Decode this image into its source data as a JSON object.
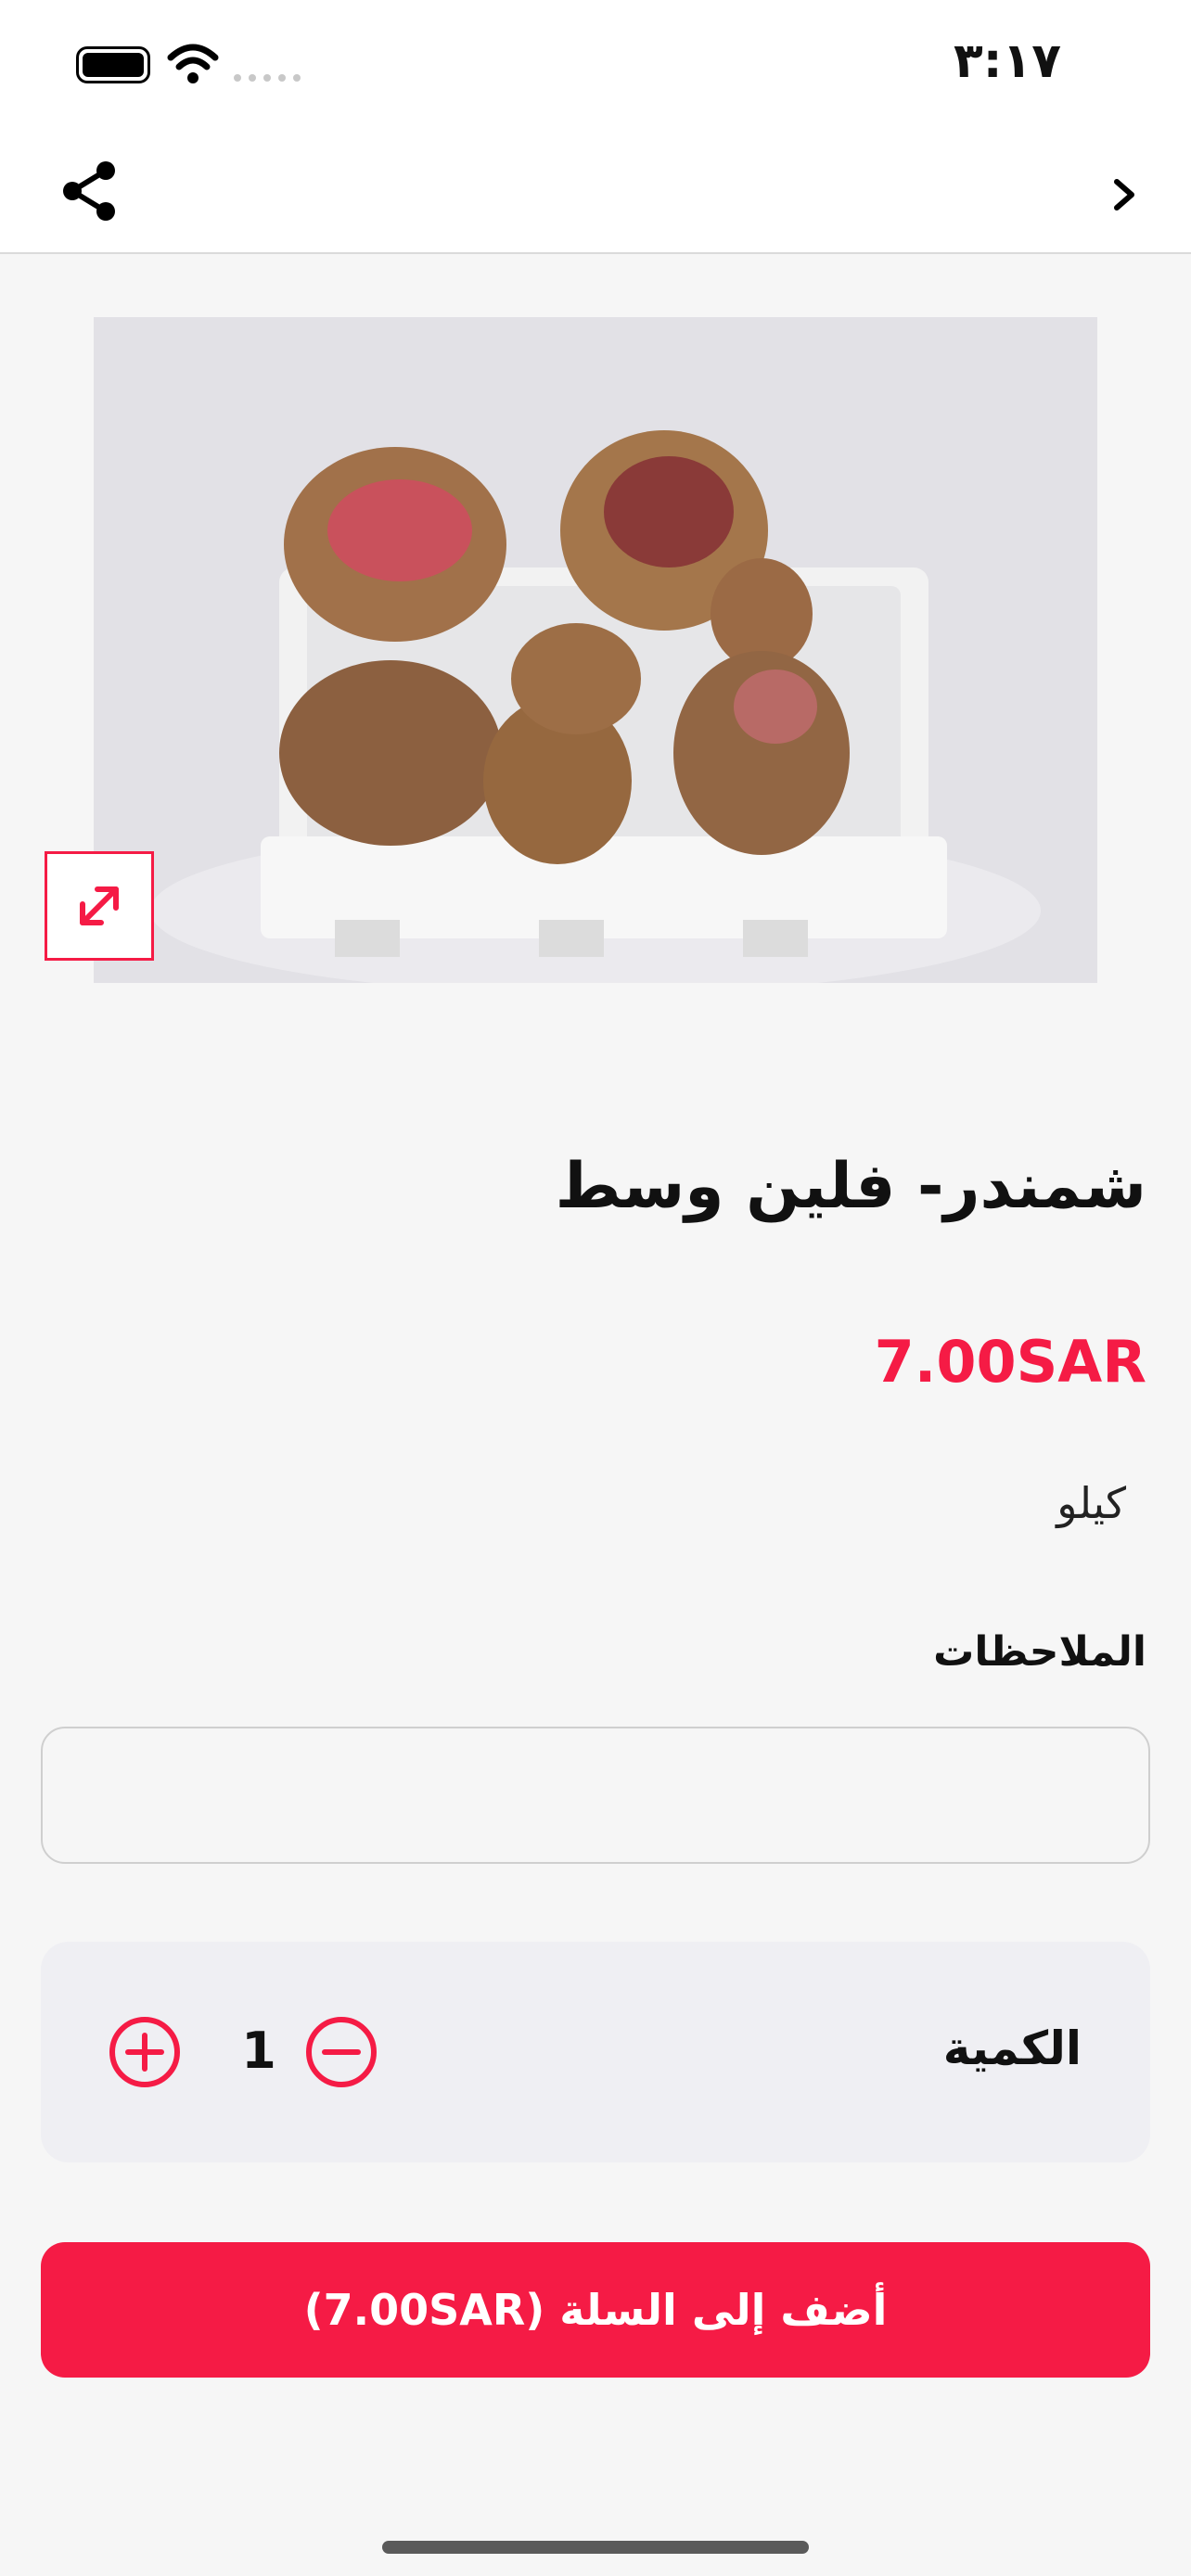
{
  "status_bar": {
    "time": "٣:١٧"
  },
  "navbar": {
    "share_icon": "share-icon",
    "back_icon": "chevron-icon"
  },
  "product": {
    "image_alt": "beetroot",
    "expand_icon": "expand-icon",
    "title": "شمندر- فلين وسط",
    "price": "7.00SAR",
    "unit": "كيلو"
  },
  "notes": {
    "label": "الملاحظات",
    "value": "",
    "placeholder": ""
  },
  "quantity": {
    "label": "الكمية",
    "value": "1"
  },
  "add_to_cart": {
    "label": "أضف إلى السلة (7.00SAR)"
  },
  "colors": {
    "accent": "#f51b45",
    "background": "#f6f6f6",
    "panel": "#efeff3"
  }
}
